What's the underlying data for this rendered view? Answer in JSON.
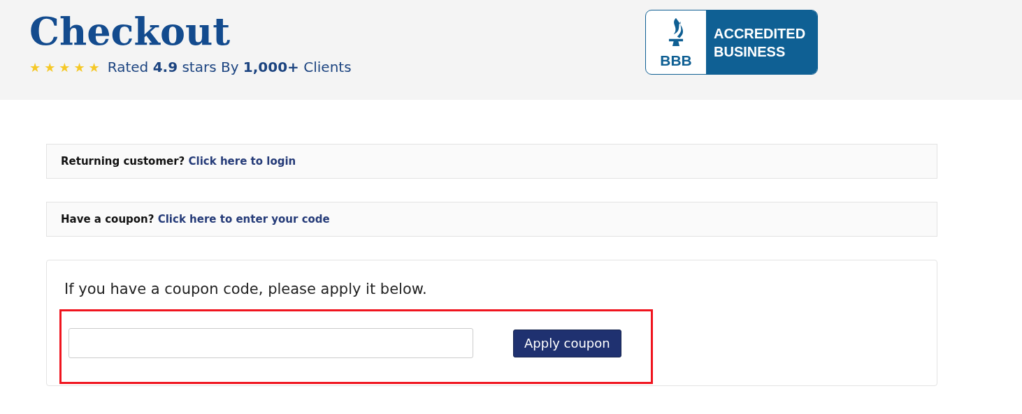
{
  "header": {
    "title": "Checkout",
    "stars": 5,
    "rating": "Rated **4.9** stars By **1,000+** Clients"
  },
  "badge": {
    "mark": "BBB",
    "text_lines": [
      "ACCREDITED",
      "BUSINESS"
    ]
  },
  "notices": [
    {
      "label": "Returning customer?",
      "link": "Click here to login"
    },
    {
      "label": "Have a coupon?",
      "link": "Click here to enter your code"
    }
  ],
  "coupon": {
    "intro": "If you have a coupon code, please apply it below.",
    "button": "Apply coupon",
    "highlighted": true
  }
}
